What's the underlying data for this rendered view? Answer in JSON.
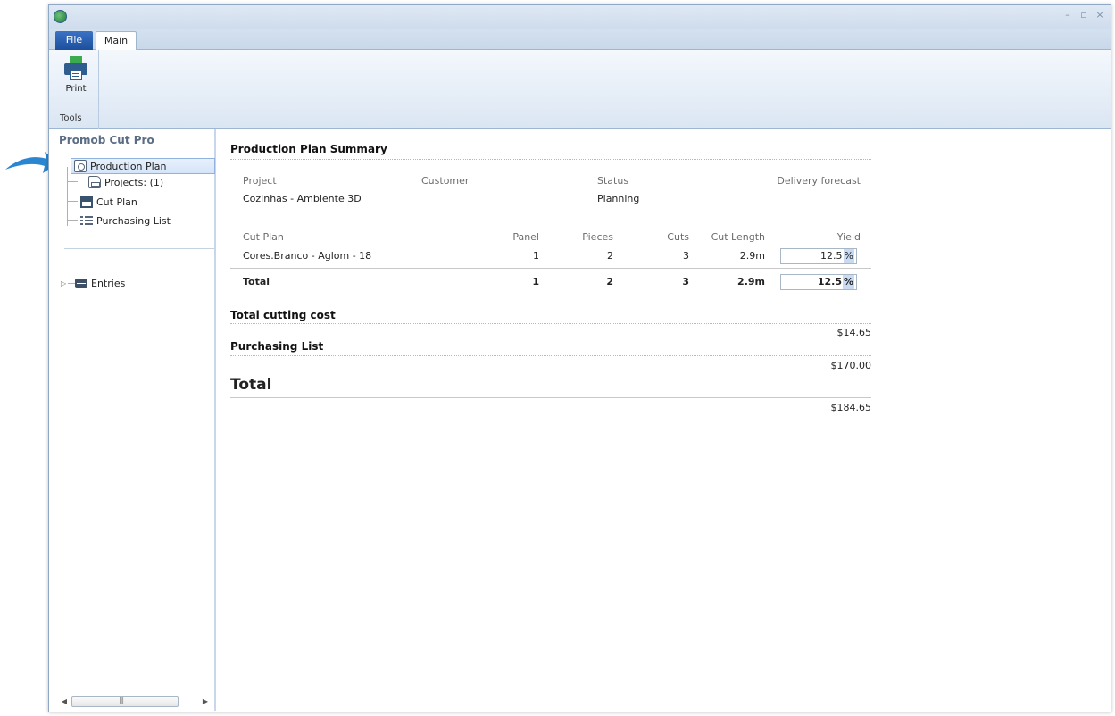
{
  "window": {
    "tabs": {
      "file": "File",
      "main": "Main"
    },
    "controls": [
      "–",
      "▫",
      "×"
    ]
  },
  "ribbon": {
    "print_label": "Print",
    "group_label": "Tools"
  },
  "tree": {
    "title": "Promob Cut Pro",
    "production_plan": "Production Plan",
    "projects": "Projects: (1)",
    "cut_plan": "Cut Plan",
    "purchasing_list": "Purchasing List",
    "entries": "Entries"
  },
  "summary": {
    "title": "Production Plan Summary",
    "headers": {
      "project": "Project",
      "customer": "Customer",
      "status": "Status",
      "delivery": "Delivery forecast"
    },
    "project": "Cozinhas - Ambiente 3D",
    "customer": "",
    "status": "Planning",
    "delivery": "",
    "cut_table": {
      "columns": [
        "Cut Plan",
        "Panel",
        "Pieces",
        "Cuts",
        "Cut Length",
        "Yield"
      ],
      "row": {
        "name": "Cores.Branco - Aglom - 18",
        "panel": "1",
        "pieces": "2",
        "cuts": "3",
        "length": "2.9m",
        "yield": "12.5",
        "pct": "%"
      },
      "total": {
        "name": "Total",
        "panel": "1",
        "pieces": "2",
        "cuts": "3",
        "length": "2.9m",
        "yield": "12.5",
        "pct": "%"
      }
    },
    "cutting_cost_title": "Total cutting cost",
    "cutting_cost": "$14.65",
    "purchasing_title": "Purchasing List",
    "purchasing_cost": "$170.00",
    "total_title": "Total",
    "total_cost": "$184.65"
  },
  "colors": {
    "accent": "#1c4f9c",
    "callout": "#2a86d0"
  }
}
